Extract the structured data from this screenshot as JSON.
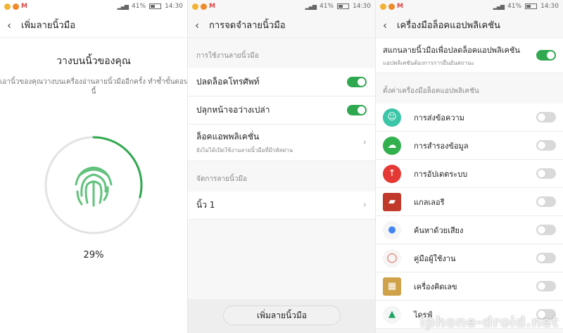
{
  "status_bar": {
    "battery": "41%",
    "time": "14:30"
  },
  "panel1": {
    "title": "เพิ่มลายนิ้วมือ",
    "heading": "วางบนนิ้วของคุณ",
    "instruction_line1": "เอานิ้วของคุณวางบนเครื่องอ่านลายนิ้วมืออีกครั้ง ทำซ้ำขั้นตอน",
    "instruction_line2": "นี้",
    "progress_label": "29%",
    "progress": 0.29
  },
  "panel2": {
    "title": "การจดจำลายนิ้วมือ",
    "section_usage": "การใช้งานลายนิ้วมือ",
    "unlock_phone": {
      "label": "ปลดล็อคโทรศัพท์",
      "on": true
    },
    "wake_screen": {
      "label": "ปลุกหน้าจอว่างเปล่า",
      "on": true
    },
    "app_lock": {
      "label": "ล็อคแอพพลิเคชั่น",
      "sublabel": "ยังไม่ได้เปิดใช้งานลายนิ้วมือที่มีรหัสผ่าน"
    },
    "section_manage": "จัดการลายนิ้วมือ",
    "finger1": "นิ้ว 1",
    "add_button": "เพิ่มลายนิ้วมือ"
  },
  "panel3": {
    "title": "เครื่องมือล็อคแอปพลิเคชัน",
    "scan_label": "สแกนลายนิ้วมือเพื่อปลดล็อคแอปพลิเคชัน",
    "scan_sublabel": "แอปพลิเคชันต้องการการยืนยันสถานะ",
    "scan_on": true,
    "section_label": "ตั้งค่าเครื่องมือล็อคแอปพลิเคชัน",
    "apps": [
      {
        "name": "การส่งข้อความ",
        "icon": "messaging-icon",
        "color": "#3cc6a8"
      },
      {
        "name": "การสำรองข้อมูล",
        "icon": "backup-icon",
        "color": "#33b04e"
      },
      {
        "name": "การอัปเดตระบบ",
        "icon": "system-update-icon",
        "color": "#e53935"
      },
      {
        "name": "แกลเลอรี",
        "icon": "gallery-icon",
        "color": "#c0392b"
      },
      {
        "name": "ค้นหาด้วยเสียง",
        "icon": "voice-search-icon",
        "color": "#4285f4"
      },
      {
        "name": "คู่มือผู้ใช้งาน",
        "icon": "user-manual-icon",
        "color": "#e0442f"
      },
      {
        "name": "เครื่องคิดเลข",
        "icon": "calculator-icon",
        "color": "#cfa24a"
      },
      {
        "name": "ไดรฟ์",
        "icon": "drive-icon",
        "color": "#1fa463"
      }
    ],
    "watermark": "iphone-droid.net"
  },
  "colors": {
    "accent": "#2fa84f",
    "toggle_off": "#d9d9d9"
  }
}
